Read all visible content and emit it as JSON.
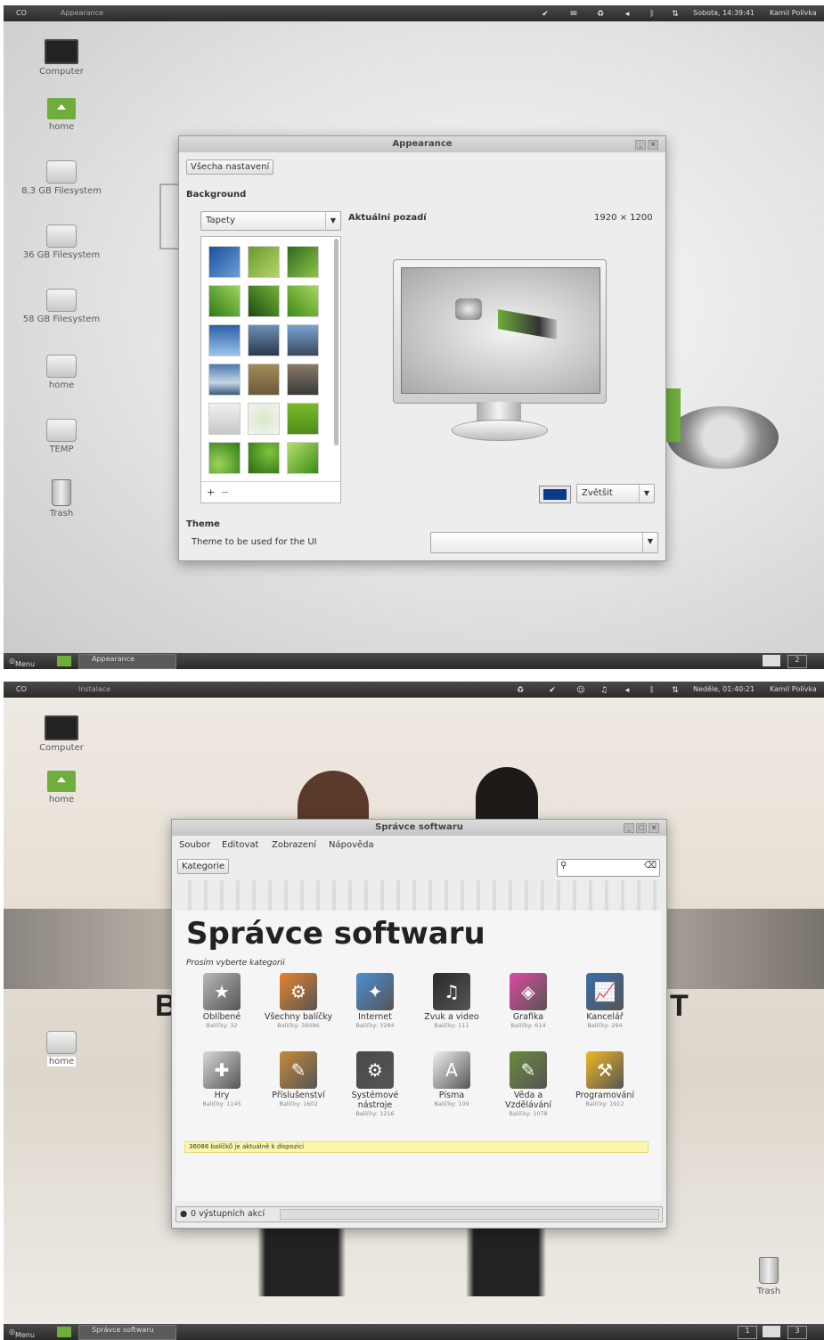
{
  "screen1": {
    "panel": {
      "app_label": "Appearance",
      "clock": "Sobota, 14:39:41",
      "user": "Kamil Polívka",
      "menu_label": "Menu",
      "task_label": "Appearance",
      "workspaces": [
        "1",
        "2"
      ]
    },
    "desktop_icons": [
      {
        "label": "Computer",
        "icon": "monitor"
      },
      {
        "label": "home",
        "icon": "folder"
      },
      {
        "label": "8,3 GB Filesystem",
        "icon": "drive"
      },
      {
        "label": "36 GB Filesystem",
        "icon": "drive"
      },
      {
        "label": "58 GB Filesystem",
        "icon": "drive"
      },
      {
        "label": "home",
        "icon": "drive"
      },
      {
        "label": "TEMP",
        "icon": "drive"
      },
      {
        "label": "Trash",
        "icon": "trash"
      }
    ],
    "window": {
      "title": "Appearance",
      "all_settings_button": "Všecha nastavení",
      "background_heading": "Background",
      "source_combo_value": "Tapety",
      "current_label": "Aktuální pozadí",
      "resolution": "1920 × 1200",
      "add_button": "+",
      "remove_button": "−",
      "color_swatch": "#0b3a8c",
      "zoom_combo_value": "Zvětšit",
      "theme_heading": "Theme",
      "theme_label": "Theme to be used for the UI",
      "theme_combo_value": ""
    }
  },
  "screen2": {
    "panel": {
      "app_label": "Instalace",
      "clock": "Neděle, 01:40:21",
      "user": "Kamil Polívka",
      "menu_label": "Menu",
      "task_label": "Správce softwaru",
      "workspaces": [
        "1",
        "2",
        "3"
      ]
    },
    "desktop_icons": [
      {
        "label": "Computer",
        "icon": "monitor"
      },
      {
        "label": "home",
        "icon": "folder"
      },
      {
        "label": "home",
        "icon": "drive"
      },
      {
        "label": "Trash",
        "icon": "trash"
      }
    ],
    "window": {
      "title": "Správce softwaru",
      "menu": [
        "Soubor",
        "Editovat",
        "Zobrazení",
        "Nápověda"
      ],
      "categories_button": "Kategorie",
      "search_placeholder": "",
      "heading": "Správce softwaru",
      "subheading": "Prosím vyberte kategorii",
      "categories": [
        {
          "name": "Oblíbené",
          "count": "Balíčky: 32",
          "color": "#b8b8b8"
        },
        {
          "name": "Všechny balíčky",
          "count": "Balíčky: 36086",
          "color": "#e8842a"
        },
        {
          "name": "Internet",
          "count": "Balíčky: 3284",
          "color": "#4a8fd4"
        },
        {
          "name": "Zvuk a video",
          "count": "Balíčky: 111",
          "color": "#2a2a2a"
        },
        {
          "name": "Grafika",
          "count": "Balíčky: 614",
          "color": "#e04aa0"
        },
        {
          "name": "Kancelář",
          "count": "Balíčky: 294",
          "color": "#3a6ea8"
        },
        {
          "name": "Hry",
          "count": "Balíčky: 1145",
          "color": "#d8d8d8"
        },
        {
          "name": "Příslušenství",
          "count": "Balíčky: 1602",
          "color": "#c7893a"
        },
        {
          "name": "Systémové nástroje",
          "count": "Balíčky: 1216",
          "color": "#4a4a4a"
        },
        {
          "name": "Písma",
          "count": "Balíčky: 109",
          "color": "#f2f2f2"
        },
        {
          "name": "Věda a Vzdělávání",
          "count": "Balíčky: 1078",
          "color": "#6a8a3a"
        },
        {
          "name": "Programování",
          "count": "Balíčky: 1912",
          "color": "#f0b820"
        }
      ],
      "available_notice": "36086 balíčků je aktuálně k dispozici",
      "status": "0 výstupních akcí"
    }
  }
}
